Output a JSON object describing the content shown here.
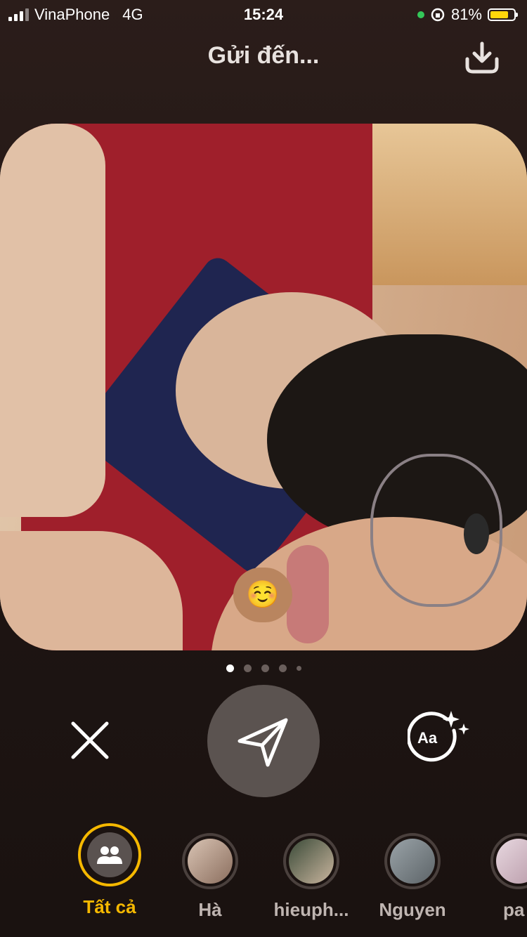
{
  "status_bar": {
    "carrier": "VinaPhone",
    "network": "4G",
    "time": "15:24",
    "battery": "81%",
    "battery_level": 0.81
  },
  "header": {
    "title": "Gửi đến...",
    "download_icon": "download-icon"
  },
  "photo": {
    "reaction_emoji": "☺️"
  },
  "pager": {
    "count": 5,
    "active_index": 0
  },
  "actions": {
    "close_icon": "close-icon",
    "send_icon": "send-icon",
    "text_icon": "text-style-icon"
  },
  "friends": [
    {
      "label": "Tất cả",
      "active": true
    },
    {
      "label": "Hà",
      "active": false
    },
    {
      "label": "hieuph...",
      "active": false
    },
    {
      "label": "Nguyen",
      "active": false
    },
    {
      "label": "pa",
      "active": false
    }
  ],
  "colors": {
    "accent": "#f5b800",
    "background": "#1e1513",
    "send_button": "#5b5350"
  }
}
